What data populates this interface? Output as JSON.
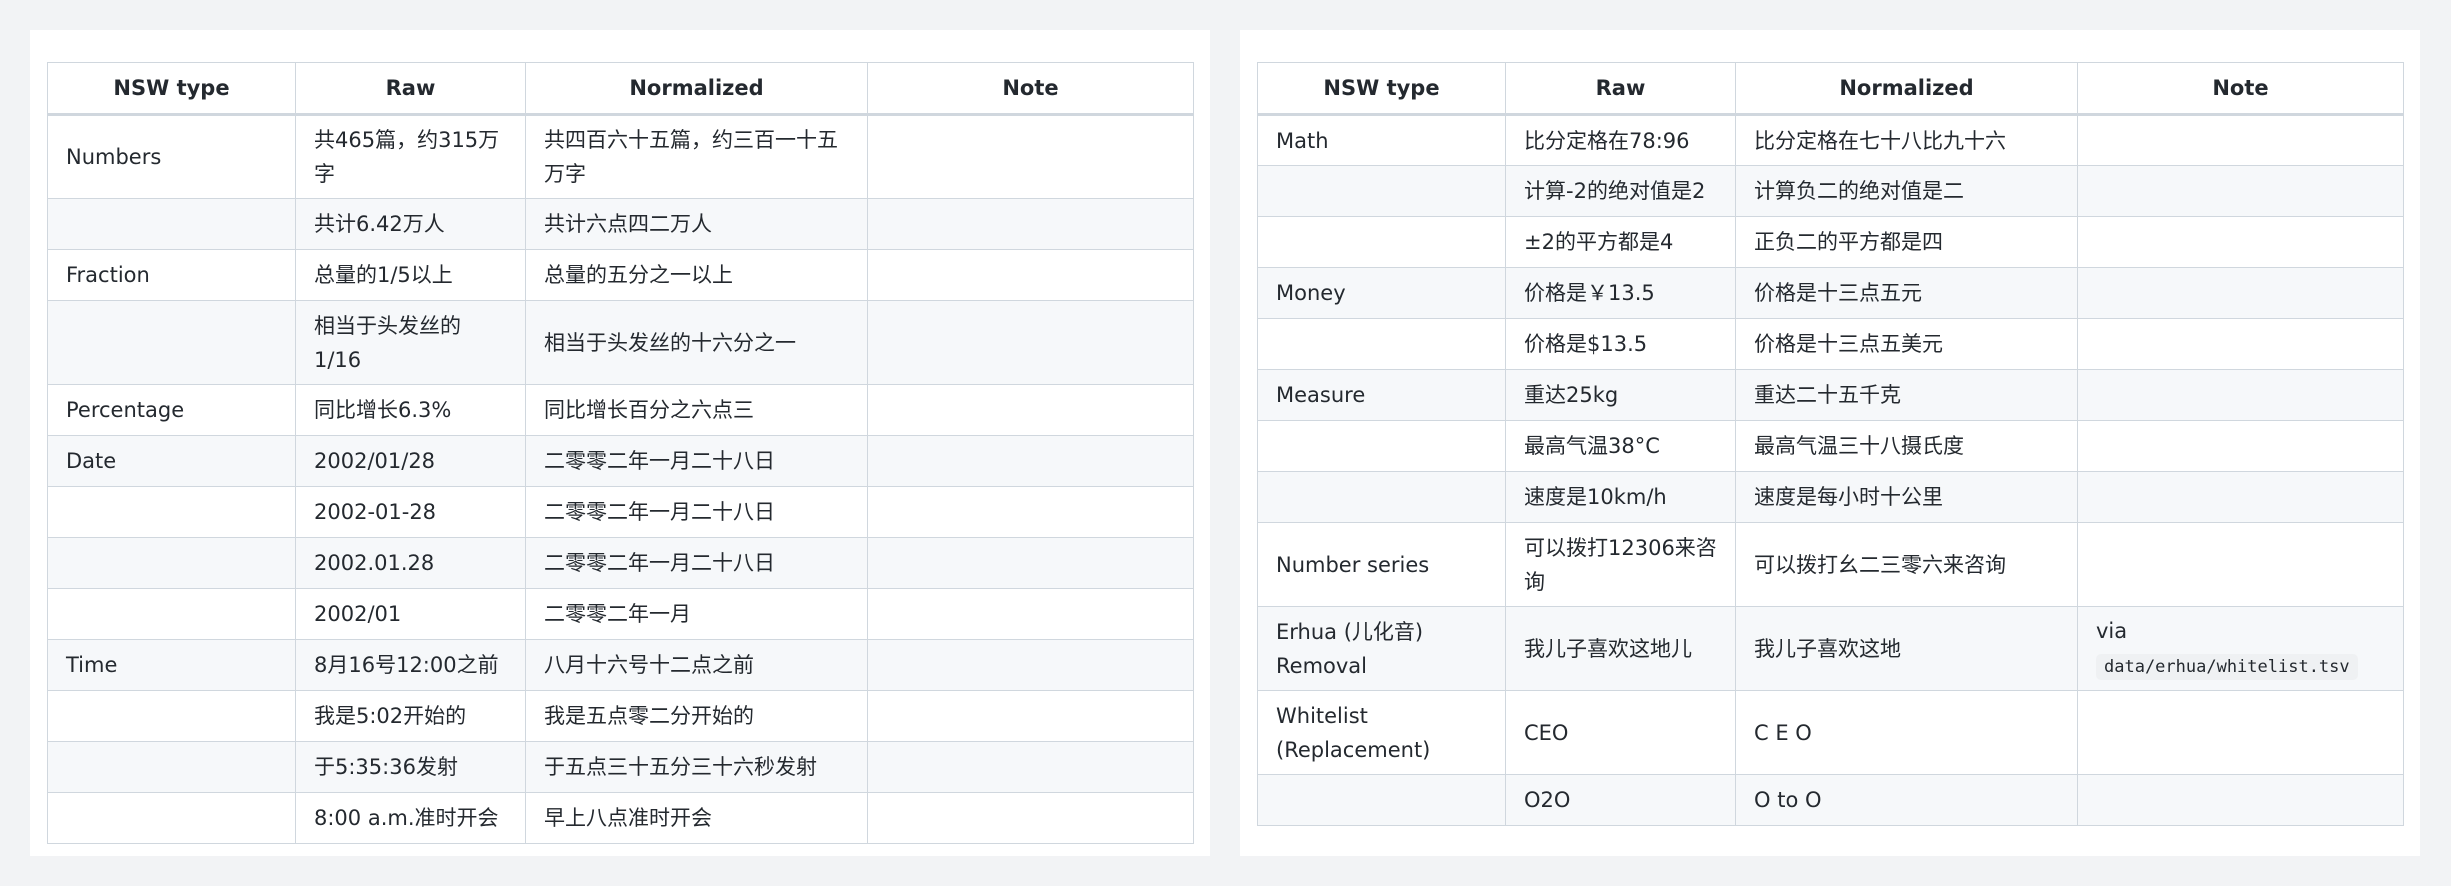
{
  "columns": [
    "NSW type",
    "Raw",
    "Normalized",
    "Note"
  ],
  "left_rows": [
    {
      "type": "Numbers",
      "raw": "共465篇，约315万字",
      "normalized": "共四百六十五篇，约三百一十五万字",
      "note": ""
    },
    {
      "type": "",
      "raw": "共计6.42万人",
      "normalized": "共计六点四二万人",
      "note": ""
    },
    {
      "type": "Fraction",
      "raw": "总量的1/5以上",
      "normalized": "总量的五分之一以上",
      "note": ""
    },
    {
      "type": "",
      "raw": "相当于头发丝的1/16",
      "normalized": "相当于头发丝的十六分之一",
      "note": ""
    },
    {
      "type": "Percentage",
      "raw": "同比增长6.3%",
      "normalized": "同比增长百分之六点三",
      "note": ""
    },
    {
      "type": "Date",
      "raw": "2002/01/28",
      "normalized": "二零零二年一月二十八日",
      "note": ""
    },
    {
      "type": "",
      "raw": "2002-01-28",
      "normalized": "二零零二年一月二十八日",
      "note": ""
    },
    {
      "type": "",
      "raw": "2002.01.28",
      "normalized": "二零零二年一月二十八日",
      "note": ""
    },
    {
      "type": "",
      "raw": "2002/01",
      "normalized": "二零零二年一月",
      "note": ""
    },
    {
      "type": "Time",
      "raw": "8月16号12:00之前",
      "normalized": "八月十六号十二点之前",
      "note": ""
    },
    {
      "type": "",
      "raw": "我是5:02开始的",
      "normalized": "我是五点零二分开始的",
      "note": ""
    },
    {
      "type": "",
      "raw": "于5:35:36发射",
      "normalized": "于五点三十五分三十六秒发射",
      "note": ""
    },
    {
      "type": "",
      "raw": "8:00 a.m.准时开会",
      "normalized": "早上八点准时开会",
      "note": ""
    }
  ],
  "right_rows": [
    {
      "type": "Math",
      "raw": "比分定格在78:96",
      "normalized": "比分定格在七十八比九十六",
      "note": ""
    },
    {
      "type": "",
      "raw": "计算-2的绝对值是2",
      "normalized": "计算负二的绝对值是二",
      "note": ""
    },
    {
      "type": "",
      "raw": "±2的平方都是4",
      "normalized": "正负二的平方都是四",
      "note": ""
    },
    {
      "type": "Money",
      "raw": "价格是￥13.5",
      "normalized": "价格是十三点五元",
      "note": ""
    },
    {
      "type": "",
      "raw": "价格是$13.5",
      "normalized": "价格是十三点五美元",
      "note": ""
    },
    {
      "type": "Measure",
      "raw": "重达25kg",
      "normalized": "重达二十五千克",
      "note": ""
    },
    {
      "type": "",
      "raw": "最高气温38°C",
      "normalized": "最高气温三十八摄氏度",
      "note": ""
    },
    {
      "type": "",
      "raw": "速度是10km/h",
      "normalized": "速度是每小时十公里",
      "note": ""
    },
    {
      "type": "Number series",
      "raw": "可以拨打12306来咨询",
      "normalized": "可以拨打幺二三零六来咨询",
      "note": ""
    },
    {
      "type": "Erhua (儿化音) Removal",
      "raw": "我儿子喜欢这地儿",
      "normalized": "我儿子喜欢这地",
      "note": "via",
      "note_code": "data/erhua/whitelist.tsv"
    },
    {
      "type": "Whitelist (Replacement)",
      "raw": "CEO",
      "normalized": "C E O",
      "note": ""
    },
    {
      "type": "",
      "raw": "O2O",
      "normalized": "O to O",
      "note": ""
    }
  ]
}
